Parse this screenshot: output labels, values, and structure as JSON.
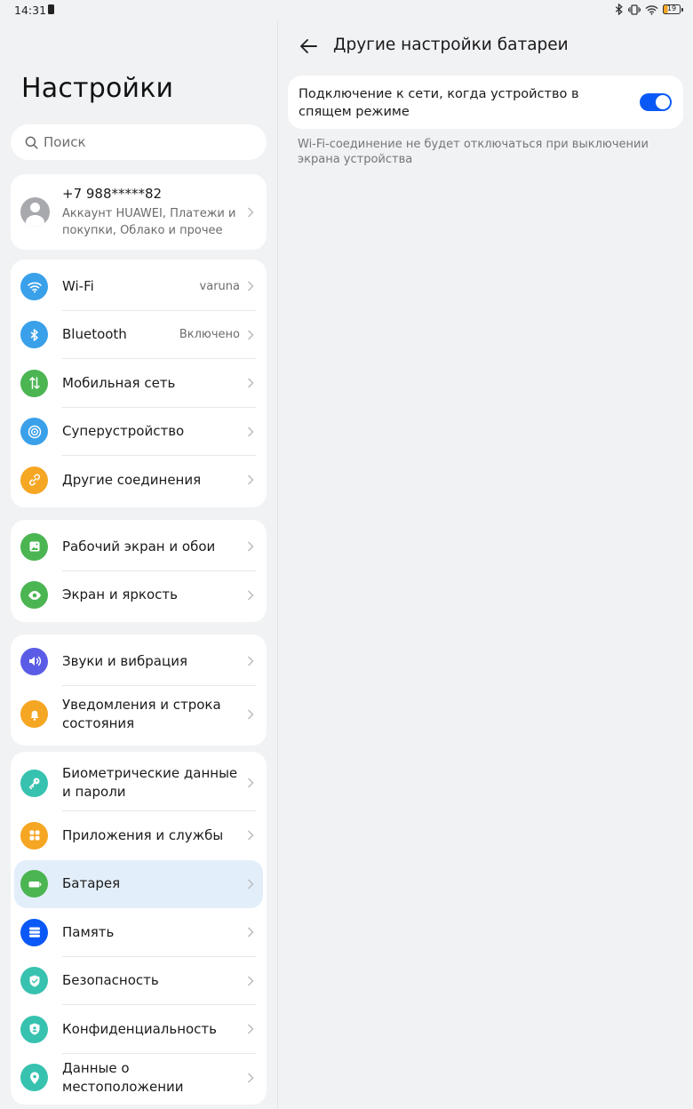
{
  "status_bar": {
    "time": "14:31",
    "battery_level": "19"
  },
  "left": {
    "title": "Настройки",
    "search_placeholder": "Поиск",
    "account": {
      "phone": "+7 988*****82",
      "subtitle": "Аккаунт HUAWEI, Платежи и покупки, Облако и прочее"
    },
    "groups": [
      [
        {
          "label": "Wi-Fi",
          "value": "varuna",
          "icon": "wifi-icon",
          "color": "#3aa0ea"
        },
        {
          "label": "Bluetooth",
          "value": "Включено",
          "icon": "bluetooth-icon",
          "color": "#3aa0ea"
        },
        {
          "label": "Мобильная сеть",
          "value": "",
          "icon": "mobile-data-icon",
          "color": "#4bb552"
        },
        {
          "label": "Суперустройство",
          "value": "",
          "icon": "super-device-icon",
          "color": "#3aa0ea"
        },
        {
          "label": "Другие соединения",
          "value": "",
          "icon": "link-icon",
          "color": "#f5a623"
        }
      ],
      [
        {
          "label": "Рабочий экран и обои",
          "value": "",
          "icon": "wallpaper-icon",
          "color": "#4bb552"
        },
        {
          "label": "Экран и яркость",
          "value": "",
          "icon": "eye-icon",
          "color": "#4bb552"
        }
      ],
      [
        {
          "label": "Звуки и вибрация",
          "value": "",
          "icon": "sound-icon",
          "color": "#5b5ce6"
        },
        {
          "label": "Уведомления и строка состояния",
          "value": "",
          "icon": "bell-icon",
          "color": "#f5a623"
        }
      ],
      [
        {
          "label": "Биометрические данные и пароли",
          "value": "",
          "icon": "key-icon",
          "color": "#37c2b0"
        },
        {
          "label": "Приложения и службы",
          "value": "",
          "icon": "apps-icon",
          "color": "#f5a623"
        },
        {
          "label": "Батарея",
          "value": "",
          "icon": "battery-icon",
          "color": "#4bb552",
          "selected": true
        },
        {
          "label": "Память",
          "value": "",
          "icon": "storage-icon",
          "color": "#0a59f7"
        },
        {
          "label": "Безопасность",
          "value": "",
          "icon": "shield-icon",
          "color": "#37c2b0"
        },
        {
          "label": "Конфиденциальность",
          "value": "",
          "icon": "privacy-icon",
          "color": "#37c2b0"
        },
        {
          "label": "Данные о местоположении",
          "value": "",
          "icon": "location-icon",
          "color": "#37c2b0"
        }
      ]
    ]
  },
  "right": {
    "title": "Другие настройки батареи",
    "setting_label": "Подключение к сети, когда устройство в спящем режиме",
    "setting_enabled": true,
    "hint": "Wi-Fi-соединение не будет отключаться при выключении экрана устройства"
  }
}
